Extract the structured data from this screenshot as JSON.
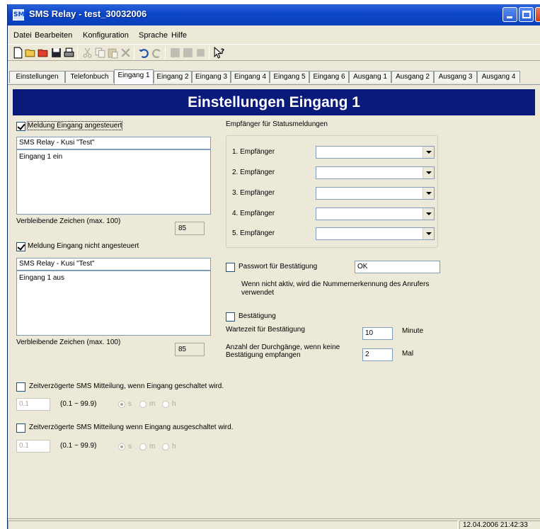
{
  "window": {
    "title": "SMS Relay - test_30032006",
    "app_icon": "SMS"
  },
  "menu": [
    "Datei",
    "Bearbeiten",
    "Konfiguration",
    "Sprache",
    "Hilfe"
  ],
  "toolbar_icons": [
    "new-document-icon",
    "open-folder-icon",
    "open-red-folder-icon",
    "save-icon",
    "print-icon",
    "cut-icon",
    "copy-icon",
    "paste-icon",
    "delete-icon",
    "undo-icon",
    "redo-icon",
    "connect-icon",
    "transfer-icon",
    "disconnect-icon",
    "help-icon"
  ],
  "tabs": [
    "Einstellungen",
    "Telefonbuch",
    "Eingang 1",
    "Eingang 2",
    "Eingang 3",
    "Eingang 4",
    "Eingang 5",
    "Eingang 6",
    "Ausgang 1",
    "Ausgang 2",
    "Ausgang 3",
    "Ausgang 4"
  ],
  "active_tab": "Eingang 1",
  "banner": "Einstellungen Eingang 1",
  "on_message": {
    "checkbox_label": "Meldung Eingang angesteuert",
    "checked": true,
    "header": "SMS Relay - Kusi \"Test\"",
    "body": "Eingang 1 ein",
    "remaining_label": "Verbleibende Zeichen (max. 100)",
    "remaining_value": "85"
  },
  "off_message": {
    "checkbox_label": "Meldung Eingang nicht angesteuert",
    "checked": true,
    "header": "SMS Relay - Kusi \"Test\"",
    "body": "Eingang 1 aus",
    "remaining_label": "Verbleibende Zeichen (max. 100)",
    "remaining_value": "85"
  },
  "recipients": {
    "title": "Empfänger für Statusmeldungen",
    "items": [
      "1. Empfänger",
      "2. Empfänger",
      "3. Empfänger",
      "4. Empfänger",
      "5. Empfänger"
    ],
    "values": [
      "",
      "",
      "",
      "",
      ""
    ]
  },
  "password": {
    "label": "Passwort für Bestätigung",
    "checked": false,
    "value": "OK",
    "note": "Wenn nicht aktiv, wird die Nummernerkennung des Anrufers verwendet"
  },
  "confirmation": {
    "label": "Bestätigung",
    "checked": false,
    "wait_label": "Wartezeit für Bestätigung",
    "wait_value": "10",
    "wait_unit": "Minute",
    "passes_label_1": "Anzahl der Durchgänge, wenn keine",
    "passes_label_2": "Bestätigung empfangen",
    "passes_value": "2",
    "passes_unit": "Mal"
  },
  "delay_on": {
    "label": "Zeitverzögerte SMS Mitteilung, wenn Eingang geschaltet wird.",
    "checked": false,
    "value": "0.1",
    "range": "(0.1 ~ 99.9)",
    "units": [
      "s",
      "m",
      "h"
    ],
    "selected_unit": "s"
  },
  "delay_off": {
    "label": "Zeitverzögerte SMS Mitteilung wenn Eingang ausgeschaltet wird.",
    "checked": false,
    "value": "0.1",
    "range": "(0.1 ~ 99.9)",
    "units": [
      "s",
      "m",
      "h"
    ],
    "selected_unit": "s"
  },
  "status": {
    "timestamp": "12.04.2006 21:42:33"
  },
  "colors": {
    "banner": "#0a1a7a",
    "titlebar": "#0b45c9",
    "face": "#ece9d8"
  }
}
